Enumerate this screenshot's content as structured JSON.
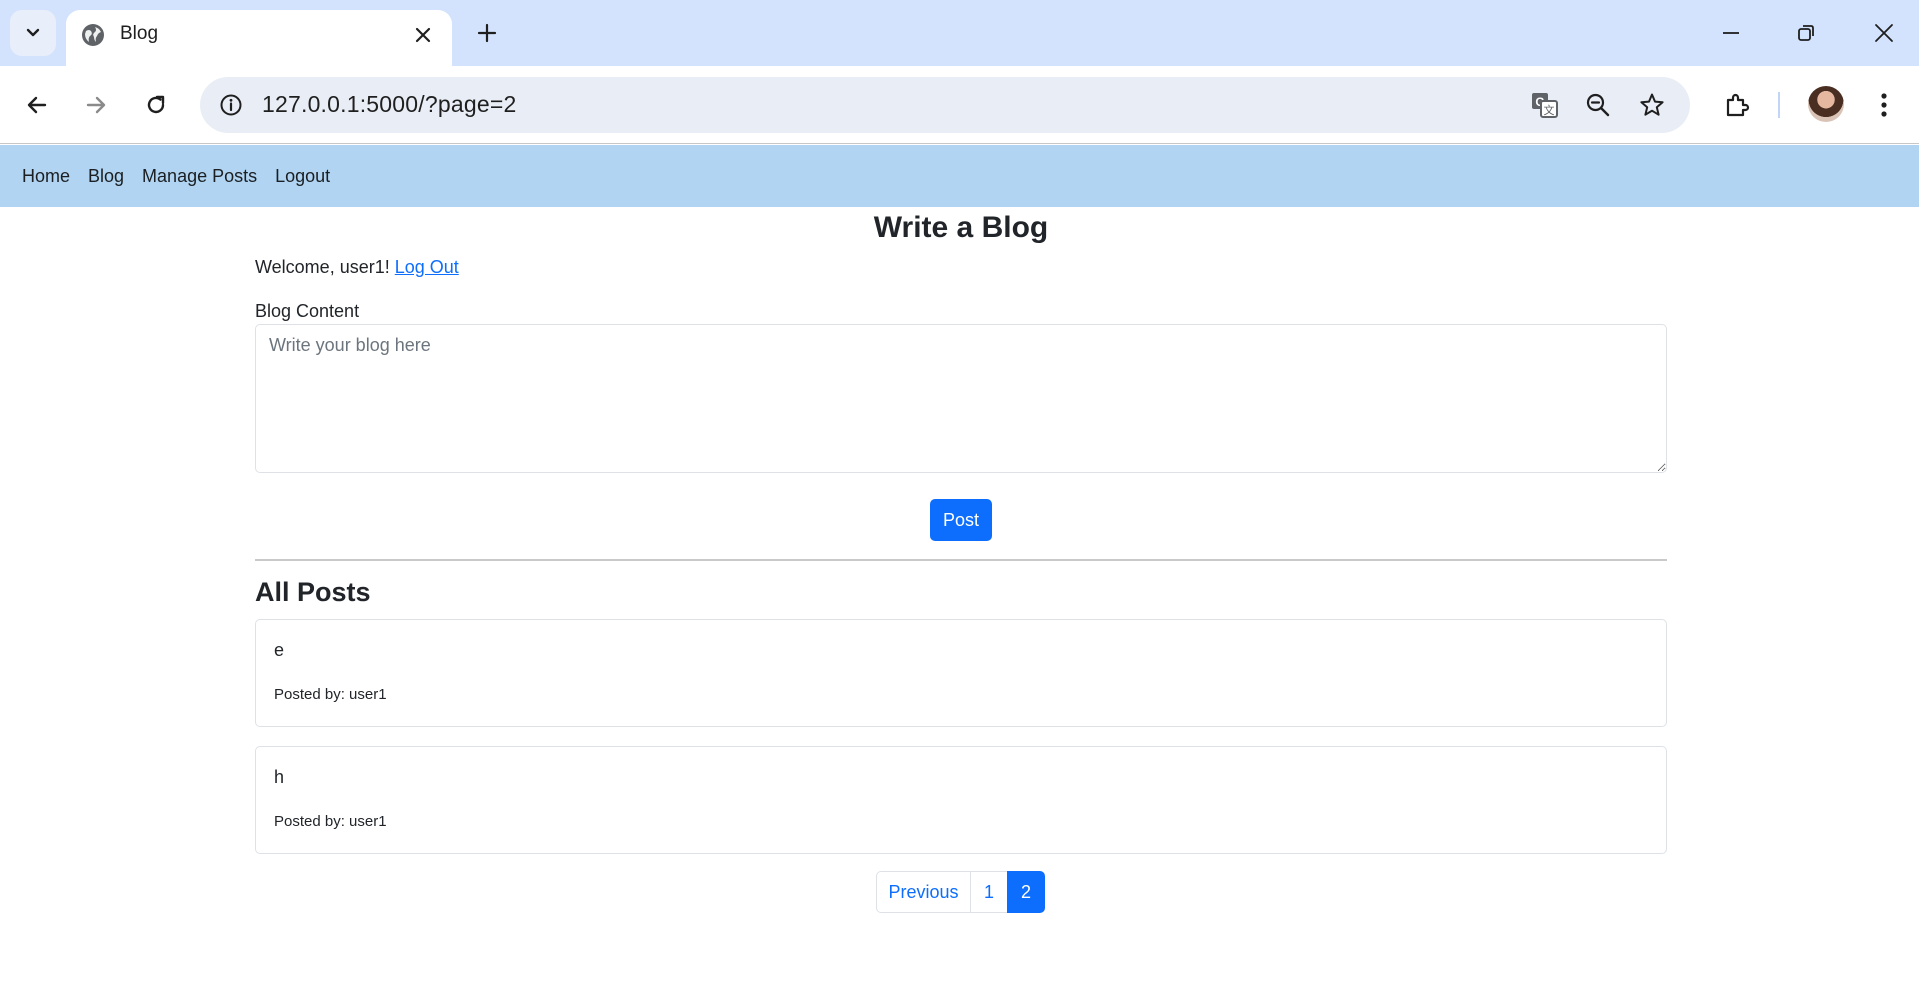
{
  "browser": {
    "tab_title": "Blog",
    "url": "127.0.0.1:5000/?page=2"
  },
  "site_nav": {
    "items": [
      "Home",
      "Blog",
      "Manage Posts",
      "Logout"
    ]
  },
  "main": {
    "title": "Write a Blog",
    "welcome_text": "Welcome, user1!",
    "logout_link": "Log Out",
    "content_label": "Blog Content",
    "content_placeholder": "Write your blog here",
    "content_value": "",
    "post_button": "Post",
    "posts_heading": "All Posts",
    "posts": [
      {
        "content": "e",
        "meta": "Posted by: user1"
      },
      {
        "content": "h",
        "meta": "Posted by: user1"
      }
    ],
    "pagination": {
      "previous": "Previous",
      "pages": [
        "1",
        "2"
      ],
      "current": "2"
    }
  },
  "colors": {
    "nav_bg": "#b0d4f1",
    "primary": "#0d6efd",
    "tabstrip_bg": "#d3e3fd"
  },
  "icons": [
    "tab-search-icon",
    "globe-icon",
    "close-icon",
    "plus-icon",
    "minimize-icon",
    "restore-icon",
    "window-close-icon",
    "back-arrow-icon",
    "forward-arrow-icon",
    "reload-icon",
    "info-icon",
    "translate-icon",
    "zoom-out-icon",
    "star-icon",
    "extensions-icon",
    "kebab-menu-icon"
  ]
}
